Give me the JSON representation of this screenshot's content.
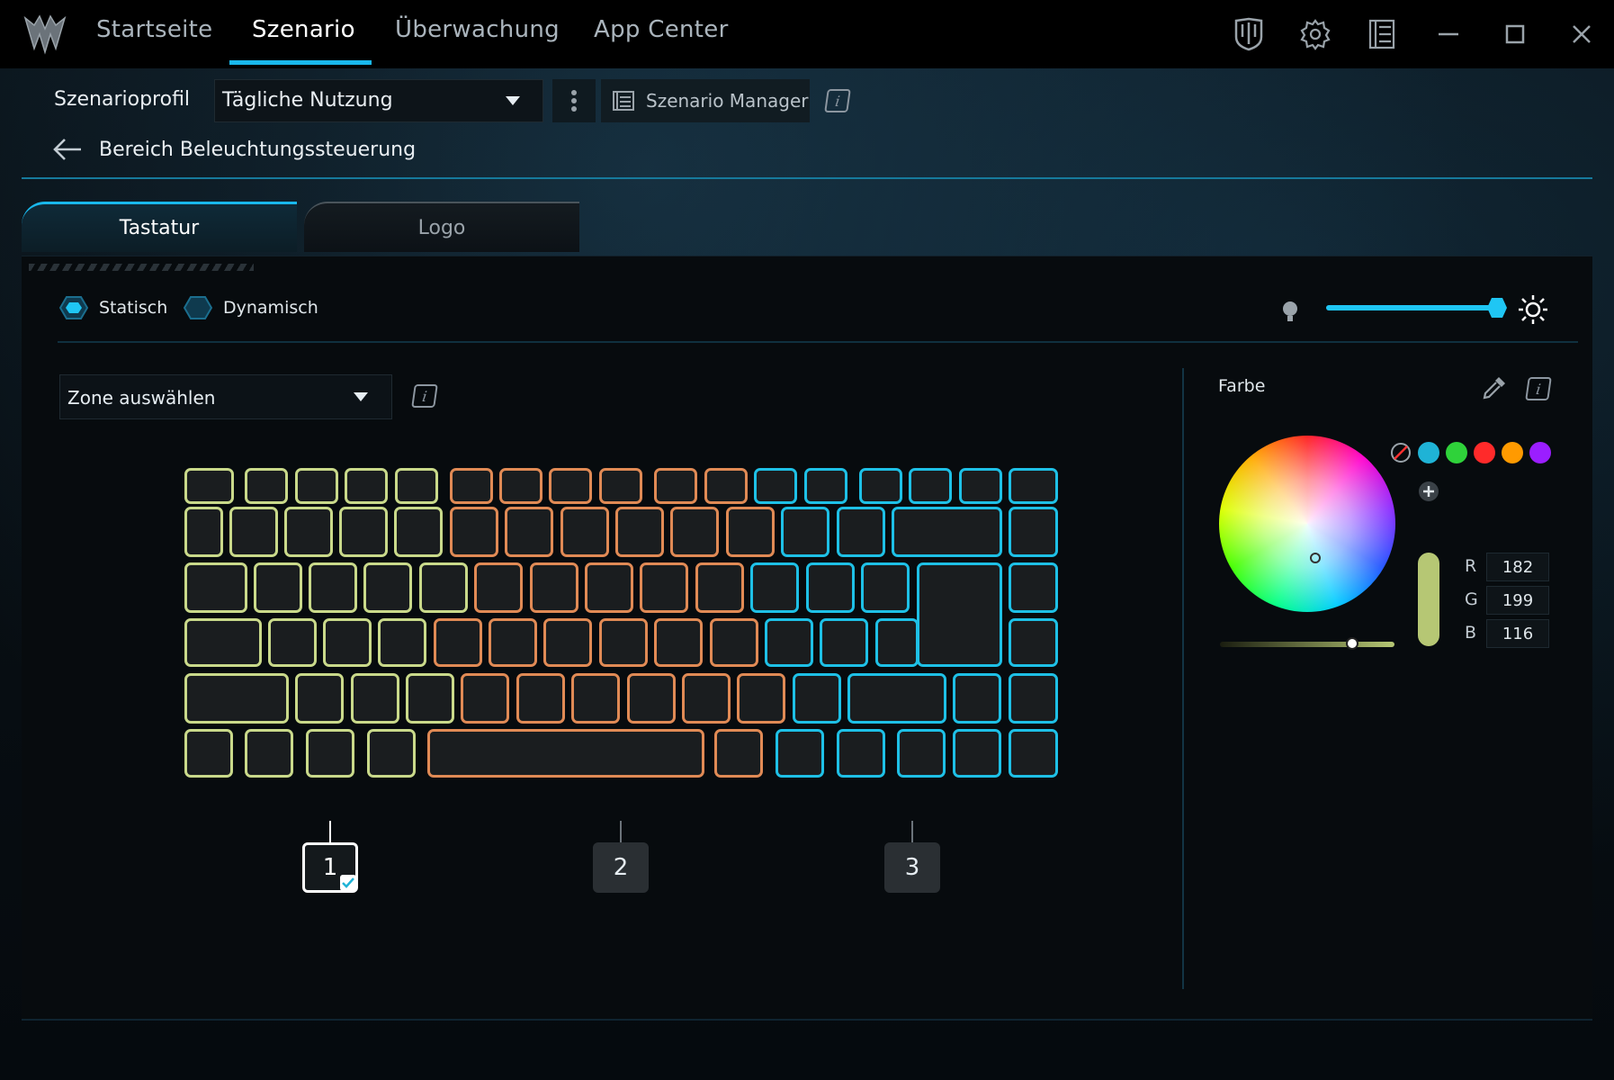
{
  "nav": {
    "tabs": [
      "Startseite",
      "Szenario",
      "Überwachung",
      "App Center"
    ],
    "active": "Szenario"
  },
  "profile": {
    "label": "Szenarioprofil",
    "selected": "Tägliche Nutzung",
    "manager_label": "Szenario Manager"
  },
  "breadcrumb": {
    "title": "Bereich Beleuchtungssteuerung"
  },
  "tabs": {
    "keyboard": "Tastatur",
    "logo": "Logo"
  },
  "mode": {
    "static": "Statisch",
    "dynamic": "Dynamisch",
    "selected": "Statisch"
  },
  "brightness": {
    "value": 1.0
  },
  "zone_select": {
    "selected": "Zone auswählen"
  },
  "zones": [
    "1",
    "2",
    "3"
  ],
  "color": {
    "label": "Farbe",
    "r_label": "R",
    "g_label": "G",
    "b_label": "B",
    "r": "182",
    "g": "199",
    "b": "116",
    "preset_colors": [
      "#1fb3d6",
      "#2fd23a",
      "#ff2a2a",
      "#ff9a00",
      "#9b1eff"
    ],
    "selected_hex": "#b6c774"
  },
  "icons": [
    "predator-logo-icon",
    "shield-icon",
    "gear-icon",
    "list-icon",
    "minimize-icon",
    "maximize-icon",
    "close-icon",
    "more-vertical-icon",
    "scenario-manager-icon",
    "info-icon",
    "back-arrow-icon",
    "bulb-dim-icon",
    "sun-bright-icon",
    "eyedropper-icon",
    "no-color-icon",
    "add-color-icon",
    "check-icon"
  ]
}
